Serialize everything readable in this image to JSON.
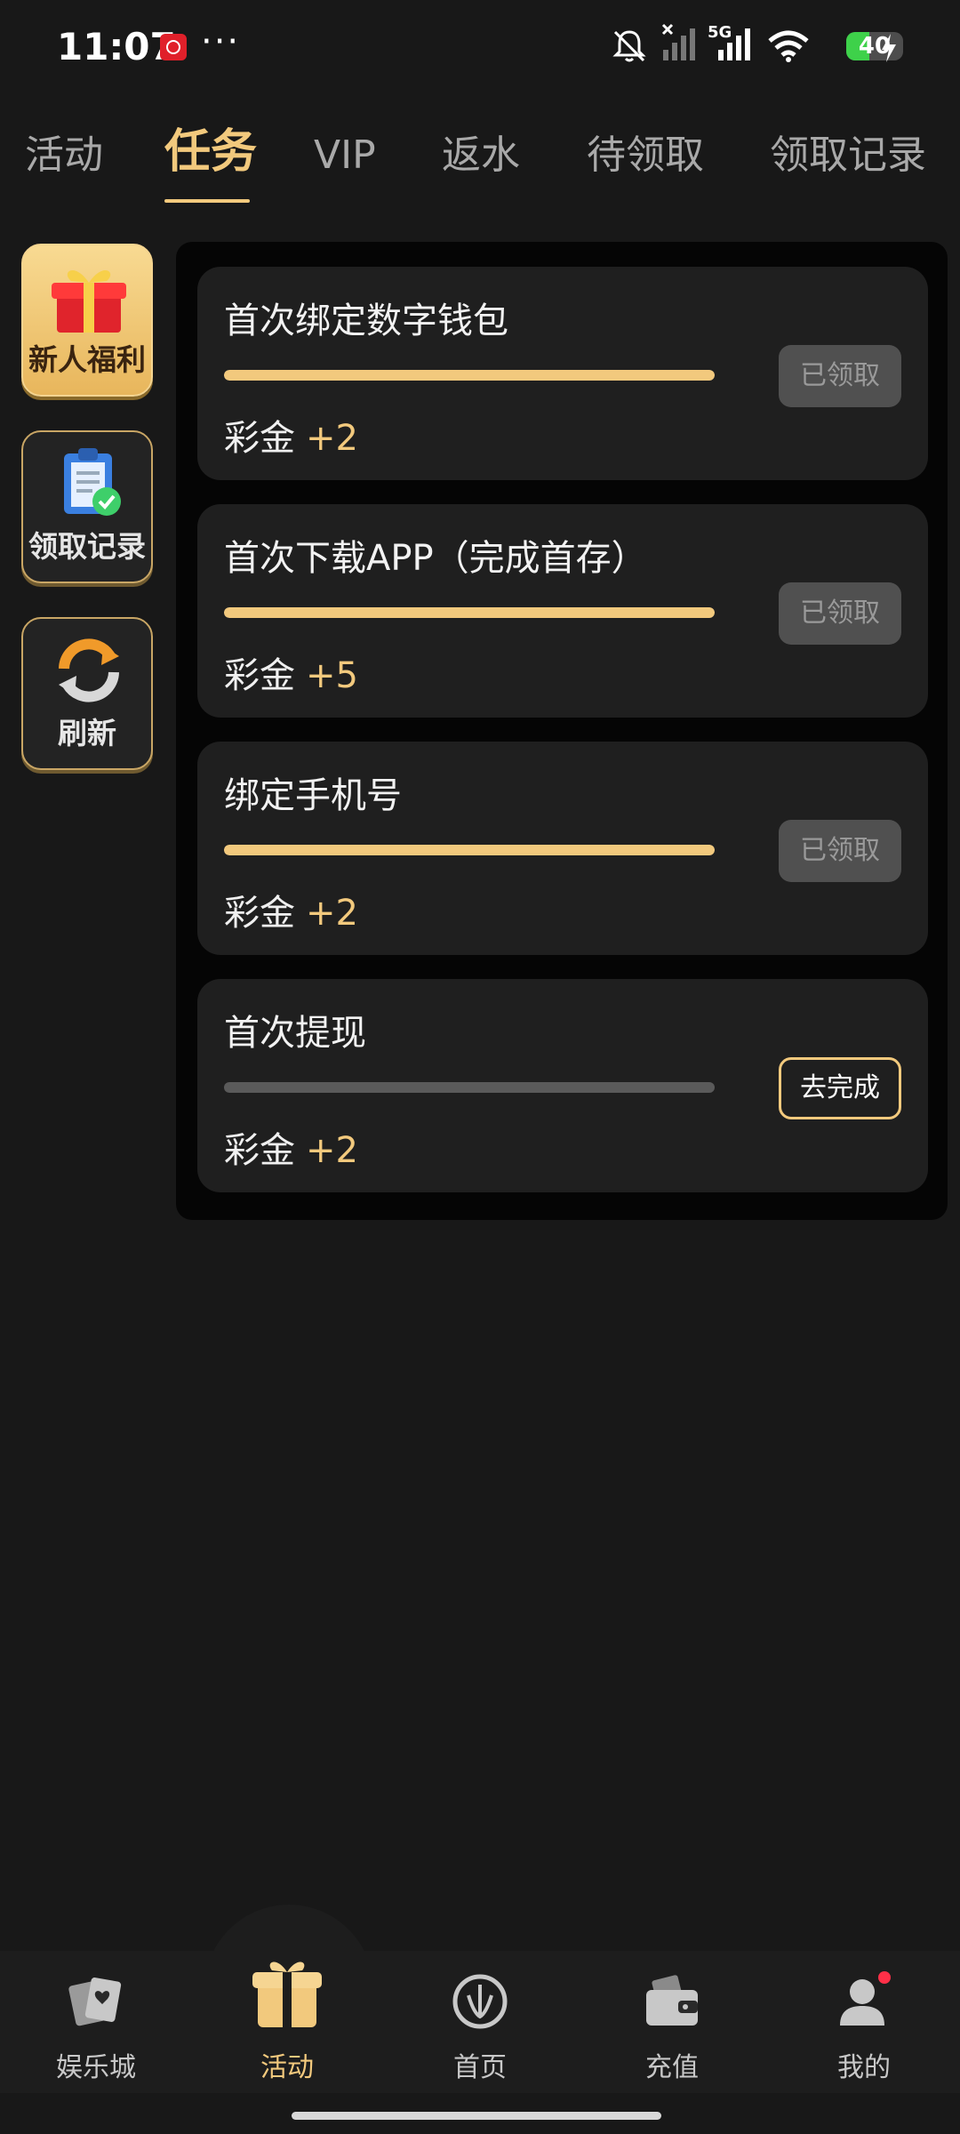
{
  "status_bar": {
    "time": "11:07",
    "network": "5G",
    "battery_level": "40",
    "battery_percent": 40
  },
  "tabs": [
    {
      "label": "活动",
      "active": false
    },
    {
      "label": "任务",
      "active": true
    },
    {
      "label": "VIP",
      "active": false
    },
    {
      "label": "返水",
      "active": false
    },
    {
      "label": "待领取",
      "active": false
    },
    {
      "label": "领取记录",
      "active": false
    }
  ],
  "side_menu": [
    {
      "label": "新人福利",
      "icon": "gift-icon"
    },
    {
      "label": "领取记录",
      "icon": "clipboard-check-icon"
    },
    {
      "label": "刷新",
      "icon": "refresh-icon"
    }
  ],
  "tasks": [
    {
      "title": "首次绑定数字钱包",
      "reward_label": "彩金",
      "reward_amount": "+2",
      "progress": 1.0,
      "button": "已领取",
      "state": "claimed"
    },
    {
      "title": "首次下载APP（完成首存）",
      "reward_label": "彩金",
      "reward_amount": "+5",
      "progress": 1.0,
      "button": "已领取",
      "state": "claimed"
    },
    {
      "title": "绑定手机号",
      "reward_label": "彩金",
      "reward_amount": "+2",
      "progress": 1.0,
      "button": "已领取",
      "state": "claimed"
    },
    {
      "title": "首次提现",
      "reward_label": "彩金",
      "reward_amount": "+2",
      "progress": 0.0,
      "button": "去完成",
      "state": "todo"
    }
  ],
  "bottom_nav": [
    {
      "label": "娱乐城",
      "icon": "cards-icon",
      "active": false
    },
    {
      "label": "活动",
      "icon": "gift-box-icon",
      "active": true
    },
    {
      "label": "首页",
      "icon": "home-logo-icon",
      "active": false
    },
    {
      "label": "充值",
      "icon": "wallet-icon",
      "active": false
    },
    {
      "label": "我的",
      "icon": "user-icon",
      "active": false,
      "badge": true
    }
  ],
  "colors": {
    "accent": "#f2c97d",
    "background": "#181818",
    "card": "#1f1f1f",
    "panel": "#050505",
    "disabled_button": "#505050"
  }
}
